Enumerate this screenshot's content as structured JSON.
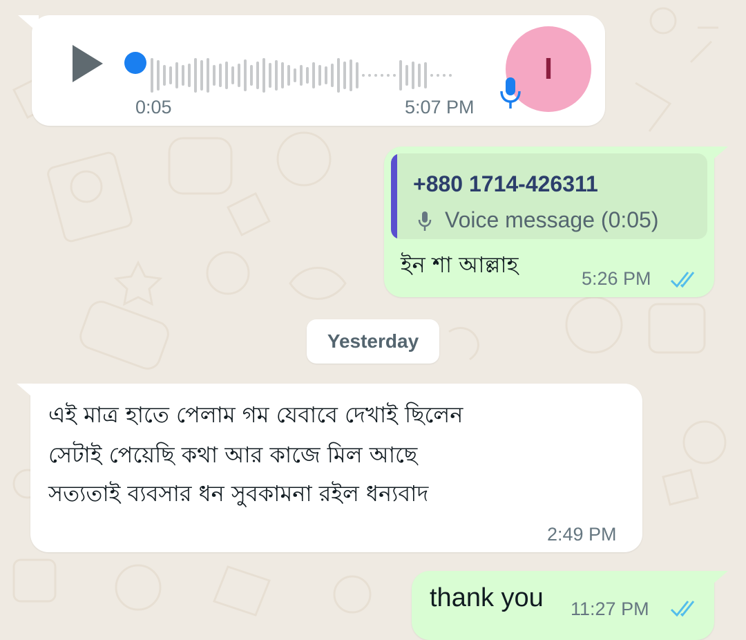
{
  "voice_message": {
    "duration": "0:05",
    "time": "5:07 PM",
    "avatar_initial": "I",
    "icon_play": "play-icon",
    "icon_mic": "mic-icon"
  },
  "reply_message": {
    "quoted_sender": "+880 1714-426311",
    "quoted_text": "Voice message (0:05)",
    "text": "ইন শা আল্লাহ",
    "time": "5:26 PM",
    "status": "read"
  },
  "date_divider": "Yesterday",
  "incoming_message": {
    "lines": [
      "এই মাত্র হাতে পেলাম গম যেবাবে দেখাই ছিলেন",
      "সেটাই পেয়েছি কথা আর কাজে মিল আছে",
      "সত্যতাই ব্যবসার ধন সুবকামনা রইল ধন্যবাদ"
    ],
    "time": "2:49 PM"
  },
  "outgoing_message": {
    "text": "thank you",
    "time": "11:27 PM",
    "status": "read"
  },
  "colors": {
    "chat_background": "#efeae2",
    "incoming_bubble": "#ffffff",
    "outgoing_bubble": "#d9fdd3",
    "read_ticks": "#53bdeb",
    "play_dot": "#1a7ff0",
    "avatar_bg": "#f5a7c3",
    "avatar_text": "#8b1e3f",
    "quote_bar": "#5a4fcf",
    "quote_sender": "#2c3e6b"
  }
}
